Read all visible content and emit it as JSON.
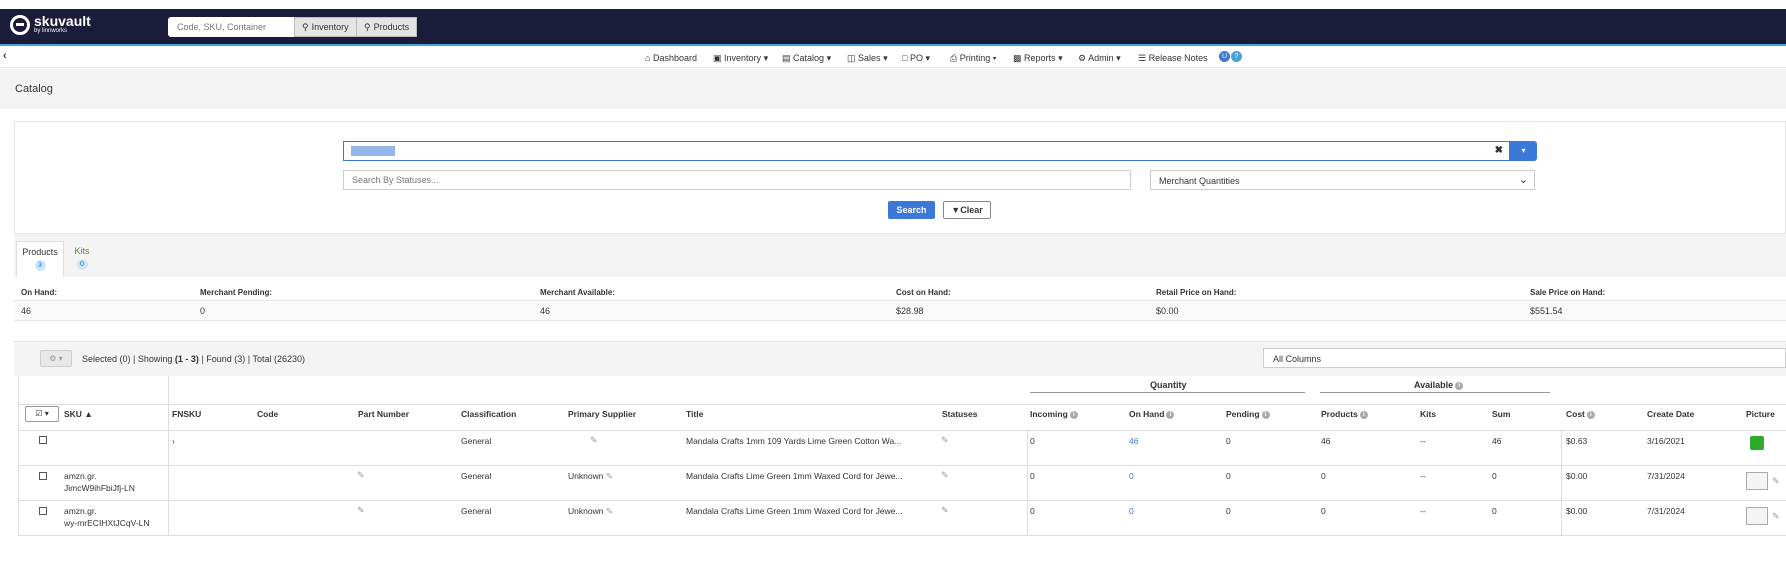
{
  "app": {
    "brand": "skuvault",
    "brand_sub": "by linnworks",
    "search_placeholder": "Code, SKU, Container",
    "inventory_btn": "Inventory",
    "products_btn": "Products"
  },
  "nav": {
    "items": [
      "Dashboard",
      "Inventory",
      "Catalog",
      "Sales",
      "PO",
      "Printing",
      "Reports",
      "Admin",
      "Release Notes"
    ]
  },
  "page": {
    "title": "Catalog"
  },
  "search": {
    "status_placeholder": "Search By Statuses...",
    "merchant_select": "Merchant Quantities",
    "search_btn": "Search",
    "clear_btn": "Clear"
  },
  "tabs": [
    {
      "label": "Products",
      "count": "3"
    },
    {
      "label": "Kits",
      "count": "0"
    }
  ],
  "summary": {
    "labels": [
      "On Hand:",
      "Merchant Pending:",
      "Merchant Available:",
      "Cost on Hand:",
      "Retail Price on Hand:",
      "Sale Price on Hand:"
    ],
    "values": [
      "46",
      "0",
      "46",
      "$28.98",
      "$0.00",
      "$551.54"
    ]
  },
  "grid": {
    "info_prefix": "Selected (0) | Showing",
    "info_range": "(1 - 3)",
    "info_suffix": "| Found (3) | Total (26230)",
    "columns_select": "All Columns",
    "group_quantity": "Quantity",
    "group_available": "Available",
    "headers": [
      "SKU",
      "FNSKU",
      "Code",
      "Part Number",
      "Classification",
      "Primary Supplier",
      "Title",
      "Statuses",
      "Incoming",
      "On Hand",
      "Pending",
      "Products",
      "Kits",
      "Sum",
      "Cost",
      "Create Date",
      "Picture"
    ],
    "rows": [
      {
        "sku": "",
        "sku2": "",
        "classification": "General",
        "supplier": "",
        "title": "Mandala Crafts 1mm 109 Yards Lime Green Cotton Wa...",
        "incoming": "0",
        "on_hand": "46",
        "pending": "0",
        "products": "46",
        "kits": "--",
        "sum": "46",
        "cost": "$0.63",
        "date": "3/16/2021"
      },
      {
        "sku": "amzn.gr.",
        "sku2": "JimcW9ihFbiJfj-LN",
        "classification": "General",
        "supplier": "Unknown",
        "title": "Mandala Crafts Lime Green 1mm Waxed Cord for Jewe...",
        "incoming": "0",
        "on_hand": "0",
        "pending": "0",
        "products": "0",
        "kits": "--",
        "sum": "0",
        "cost": "$0.00",
        "date": "7/31/2024"
      },
      {
        "sku": "amzn.gr.",
        "sku2": "wy-mrECIHXtJCqV-LN",
        "classification": "General",
        "supplier": "Unknown",
        "title": "Mandala Crafts Lime Green 1mm Waxed Cord for Jewe...",
        "incoming": "0",
        "on_hand": "0",
        "pending": "0",
        "products": "0",
        "kits": "--",
        "sum": "0",
        "cost": "$0.00",
        "date": "7/31/2024"
      }
    ]
  }
}
